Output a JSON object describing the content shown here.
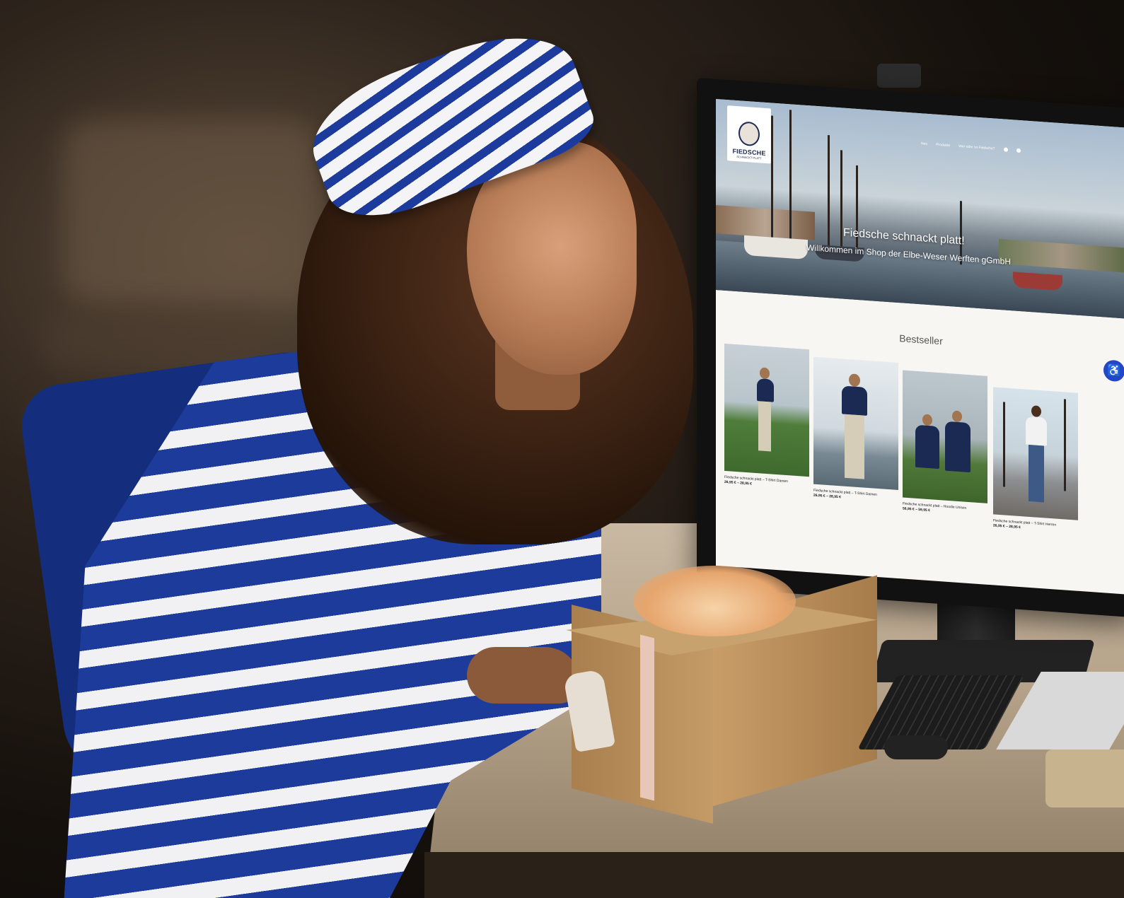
{
  "scene": {
    "description_colors": {
      "stripe_blue": "#1d3a9d",
      "stripe_white": "#f1f1f4",
      "desk": "#c9b9a3",
      "gift": "#c49a66"
    }
  },
  "website": {
    "logo": {
      "brand": "FIEDSCHE",
      "tagline": "SCHNACKT PLATT"
    },
    "nav": [
      "Neu",
      "Produkte",
      "Wer oder ist Fiedsche?"
    ],
    "hero": {
      "title": "Fiedsche schnackt platt!",
      "subtitle": "Willkommen im Shop der Elbe-Weser Werften gGmbH"
    },
    "section_title": "Bestseller",
    "products": [
      {
        "caption": "Fiedsche schnackt platt – T-Shirt Damen",
        "price": "26,95 € – 28,95 €"
      },
      {
        "caption": "Fiedsche schnackt platt – T-Shirt Damen",
        "price": "26,95 € – 28,95 €"
      },
      {
        "caption": "Fiedsche schnackt platt – Hoodie Unisex",
        "price": "56,95 € – 59,95 €"
      },
      {
        "caption": "Fiedsche schnackt platt – T-Shirt Herren",
        "price": "26,95 € – 28,95 €"
      }
    ],
    "accessibility_icon": "accessibility-icon"
  }
}
